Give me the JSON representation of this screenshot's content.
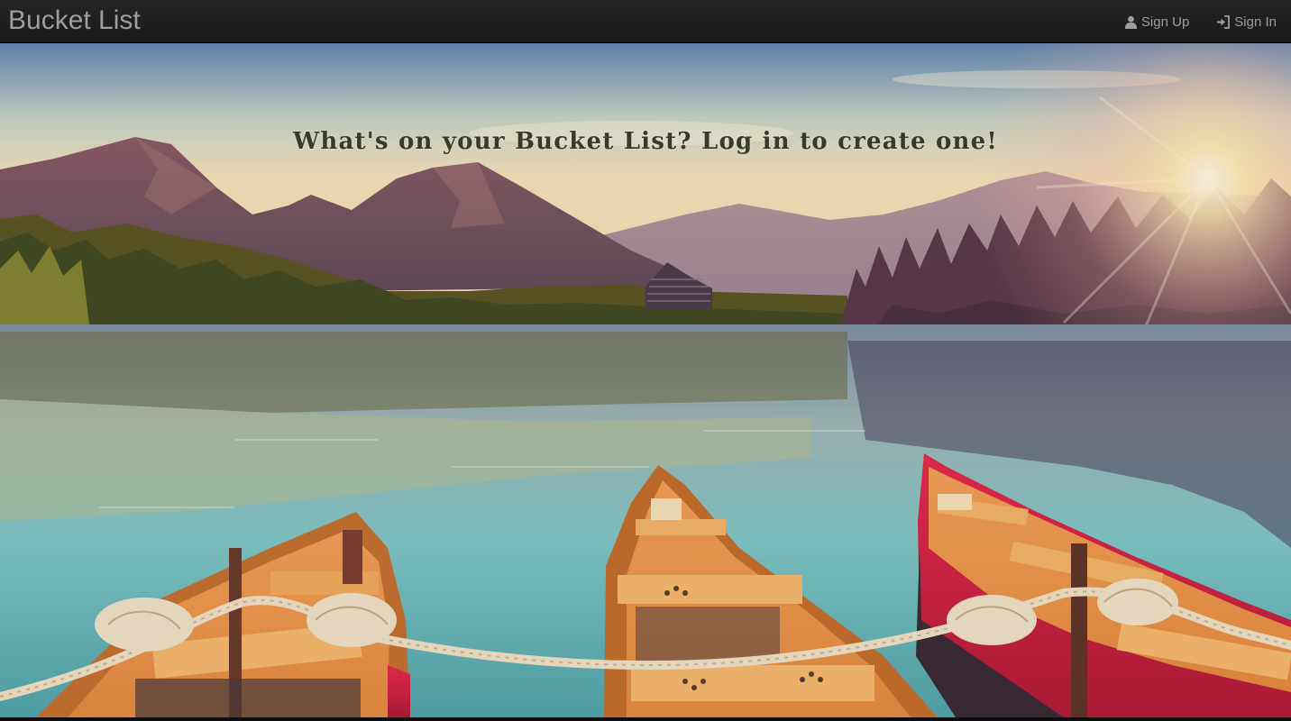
{
  "navbar": {
    "brand": "Bucket List",
    "links": [
      {
        "label": "Sign Up",
        "icon": "user-icon"
      },
      {
        "label": "Sign In",
        "icon": "sign-in-icon"
      }
    ]
  },
  "hero": {
    "headline": "What's on your Bucket List? Log in to create one!",
    "background_image": "lake-with-mountains-and-rowboats"
  },
  "colors": {
    "navbar_bg": "#1f1f1f",
    "nav_text": "#9d9d9d",
    "headline_text": "#3a3a2c"
  }
}
